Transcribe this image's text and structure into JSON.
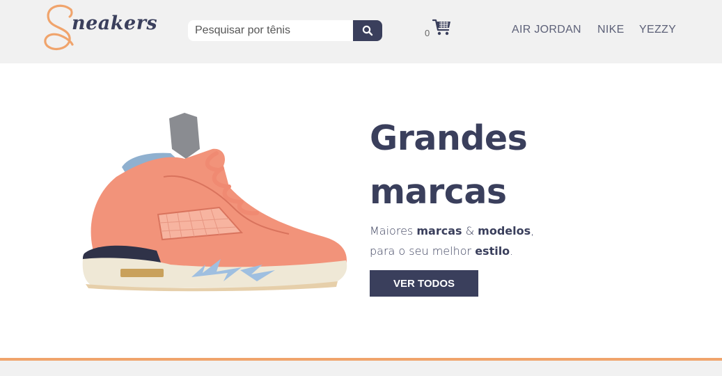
{
  "header": {
    "logo_text": "neakers",
    "search": {
      "placeholder": "Pesquisar por tênis",
      "value": "",
      "button_icon": "search-icon"
    },
    "cart": {
      "count": "0",
      "icon": "shopping-cart-icon"
    },
    "nav": [
      {
        "label": "AIR JORDAN"
      },
      {
        "label": "NIKE"
      },
      {
        "label": "YEZZY"
      }
    ]
  },
  "hero": {
    "title_line1": "Grandes",
    "title_line2": "marcas",
    "subtitle": {
      "line1_pre": "Maiores ",
      "line1_bold1": "marcas",
      "line1_mid": " & ",
      "line1_bold2": "modelos",
      "line1_post": ",",
      "line2_pre": "para o seu melhor ",
      "line2_bold": "estilo",
      "line2_post": "."
    },
    "cta_label": "VER TODOS",
    "image_icon": "sneaker-image"
  },
  "colors": {
    "brand_navy": "#3a3f5c",
    "accent_orange": "#f0a46c",
    "header_bg": "#f1f1f1",
    "sneaker_salmon": "#f2937a"
  }
}
